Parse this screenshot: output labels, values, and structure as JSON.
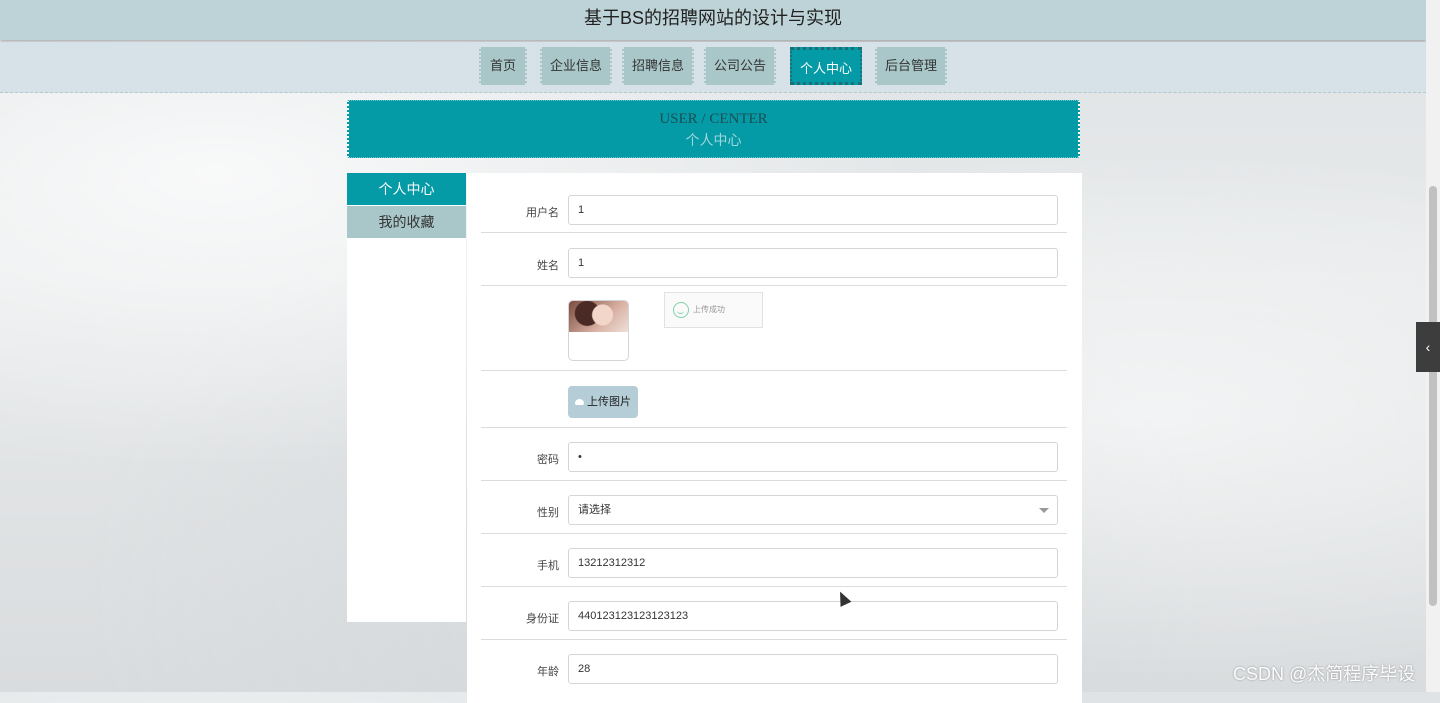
{
  "site": {
    "title": "基于BS的招聘网站的设计与实现"
  },
  "nav": {
    "items": [
      {
        "label": "首页",
        "active": false
      },
      {
        "label": "企业信息",
        "active": false
      },
      {
        "label": "招聘信息",
        "active": false
      },
      {
        "label": "公司公告",
        "active": false
      },
      {
        "label": "个人中心",
        "active": true
      },
      {
        "label": "后台管理",
        "active": false
      }
    ]
  },
  "banner": {
    "en": "USER / CENTER",
    "cn": "个人中心"
  },
  "sidebar": {
    "items": [
      {
        "label": "个人中心",
        "active": true
      },
      {
        "label": "我的收藏",
        "active": false
      }
    ]
  },
  "form": {
    "username": {
      "label": "用户名",
      "value": "1"
    },
    "name": {
      "label": "姓名",
      "value": "1"
    },
    "avatar": {
      "toast": "上传成功"
    },
    "upload": {
      "label": "上传图片"
    },
    "password": {
      "label": "密码",
      "value": "•"
    },
    "gender": {
      "label": "性别",
      "placeholder": "请选择"
    },
    "phone": {
      "label": "手机",
      "value": "13212312312"
    },
    "id_card": {
      "label": "身份证",
      "value": "440123123123123123"
    },
    "age": {
      "label": "年龄",
      "value": "28"
    }
  },
  "watermark": "CSDN @杰简程序毕设",
  "colors": {
    "accent": "#049aa6",
    "nav_bg": "#a9c7c9"
  }
}
